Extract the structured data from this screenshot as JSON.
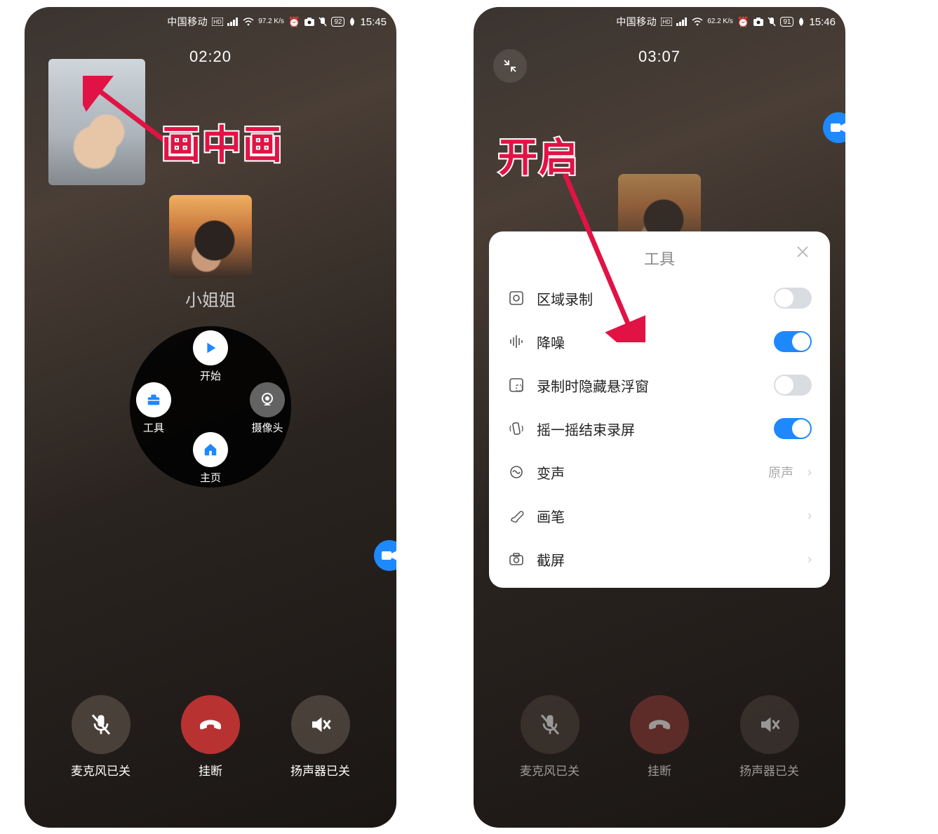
{
  "left": {
    "statusbar": {
      "carrier": "中国移动",
      "net_speed": "97.2 K/s",
      "battery": "92",
      "time": "15:45"
    },
    "call_duration": "02:20",
    "contact_name": "小姐姐",
    "radial": {
      "top": {
        "label": "开始"
      },
      "left": {
        "label": "工具"
      },
      "right": {
        "label": "摄像头"
      },
      "bottom": {
        "label": "主页"
      }
    },
    "controls": {
      "mic": "麦克风已关",
      "hangup": "挂断",
      "speaker": "扬声器已关"
    },
    "annotation": "画中画"
  },
  "right": {
    "statusbar": {
      "carrier": "中国移动",
      "net_speed": "62.2 K/s",
      "battery": "91",
      "time": "15:46"
    },
    "call_duration": "03:07",
    "panel": {
      "title": "工具",
      "rows": [
        {
          "label": "区域录制",
          "type": "toggle",
          "on": false
        },
        {
          "label": "降噪",
          "type": "toggle",
          "on": true
        },
        {
          "label": "录制时隐藏悬浮窗",
          "type": "toggle",
          "on": false
        },
        {
          "label": "摇一摇结束录屏",
          "type": "toggle",
          "on": true
        },
        {
          "label": "变声",
          "type": "link",
          "value": "原声"
        },
        {
          "label": "画笔",
          "type": "link"
        },
        {
          "label": "截屏",
          "type": "link"
        }
      ]
    },
    "controls": {
      "mic": "麦克风已关",
      "hangup": "挂断",
      "speaker": "扬声器已关"
    },
    "annotation": "开启"
  }
}
